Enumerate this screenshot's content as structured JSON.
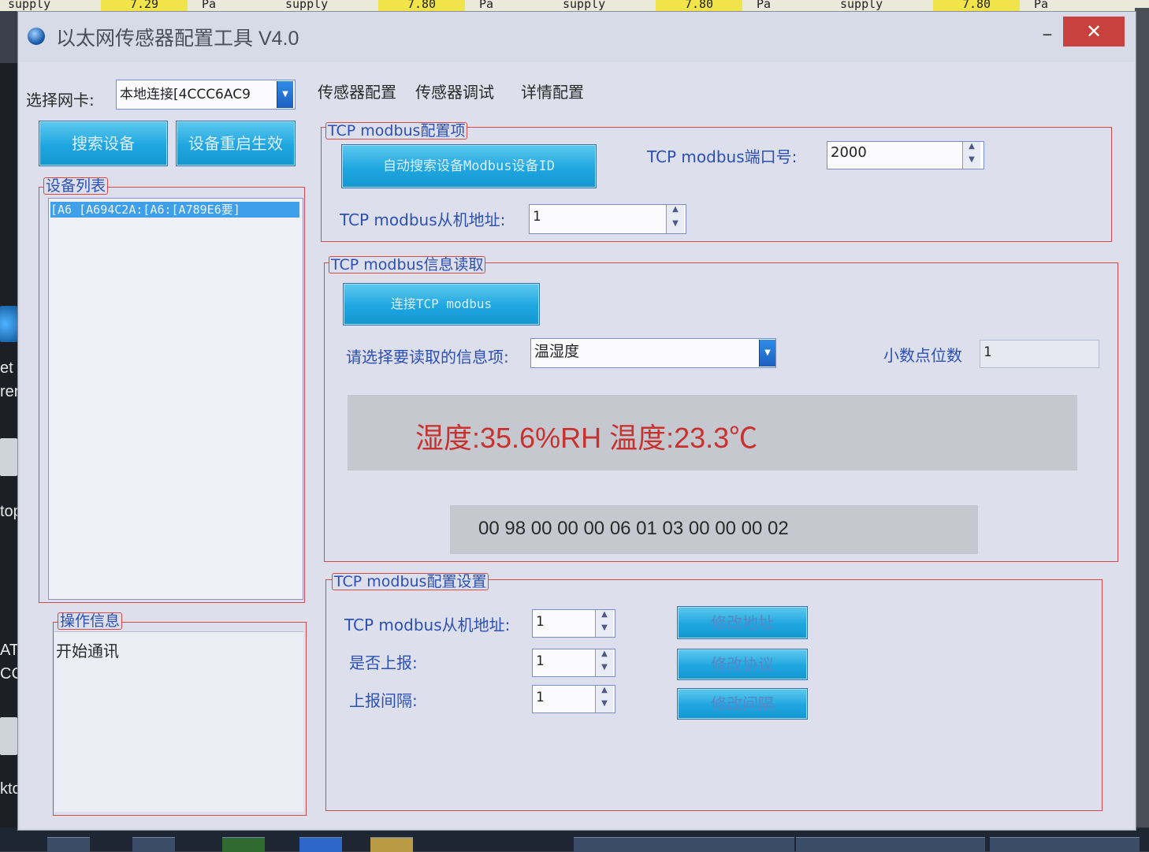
{
  "background": {
    "strip_texts": [
      "supply",
      "7.29",
      "Pa",
      "supply",
      "7.80",
      "Pa",
      "supply",
      "7.80",
      "Pa",
      "supply",
      "7.80",
      "Pa"
    ],
    "desktop_labels": [
      "et",
      "rer",
      "top",
      "ATIC",
      "CC...",
      "ktop"
    ]
  },
  "window": {
    "title": "以太网传感器配置工具 V4.0",
    "minimize": "–",
    "close": "✕"
  },
  "toolbar": {
    "nic_label": "选择网卡:",
    "nic_value": "本地连接[4CCC6AC9",
    "tabs": [
      "传感器配置",
      "传感器调试",
      "详情配置"
    ]
  },
  "left": {
    "search_button": "搜索设备",
    "restart_button": "设备重启生效",
    "device_list_title": "设备列表",
    "devices": [
      "[A6 [A694C2A:[A6:[A789E6要]"
    ],
    "log_title": "操作信息",
    "log_text": "开始通讯"
  },
  "config_group": {
    "title": "TCP  modbus配置项",
    "auto_search_button": "自动搜索设备Modbus设备ID",
    "port_label": "TCP modbus端口号:",
    "port_value": "2000",
    "slave_label": "TCP modbus从机地址:",
    "slave_value": "1"
  },
  "read_group": {
    "title": "TCP  modbus信息读取",
    "connect_button": "连接TCP  modbus",
    "select_label": "请选择要读取的信息项:",
    "select_value": "温湿度",
    "decimal_label": "小数点位数",
    "decimal_value": "1",
    "reading": "湿度:35.6%RH  温度:23.3℃",
    "hex_frame": "00 98 00 00 00 06 01 03 00 00 00 02",
    "reading_color": "#c8322e"
  },
  "setting_group": {
    "title": "TCP  modbus配置设置",
    "slave_label": "TCP modbus从机地址:",
    "slave_value": "1",
    "report_label": "是否上报:",
    "report_value": "1",
    "interval_label": "上报间隔:",
    "interval_value": "1",
    "modify_address_button": "修改地址",
    "modify_protocol_button": "修改协议",
    "modify_interval_button": "修改间隔"
  }
}
